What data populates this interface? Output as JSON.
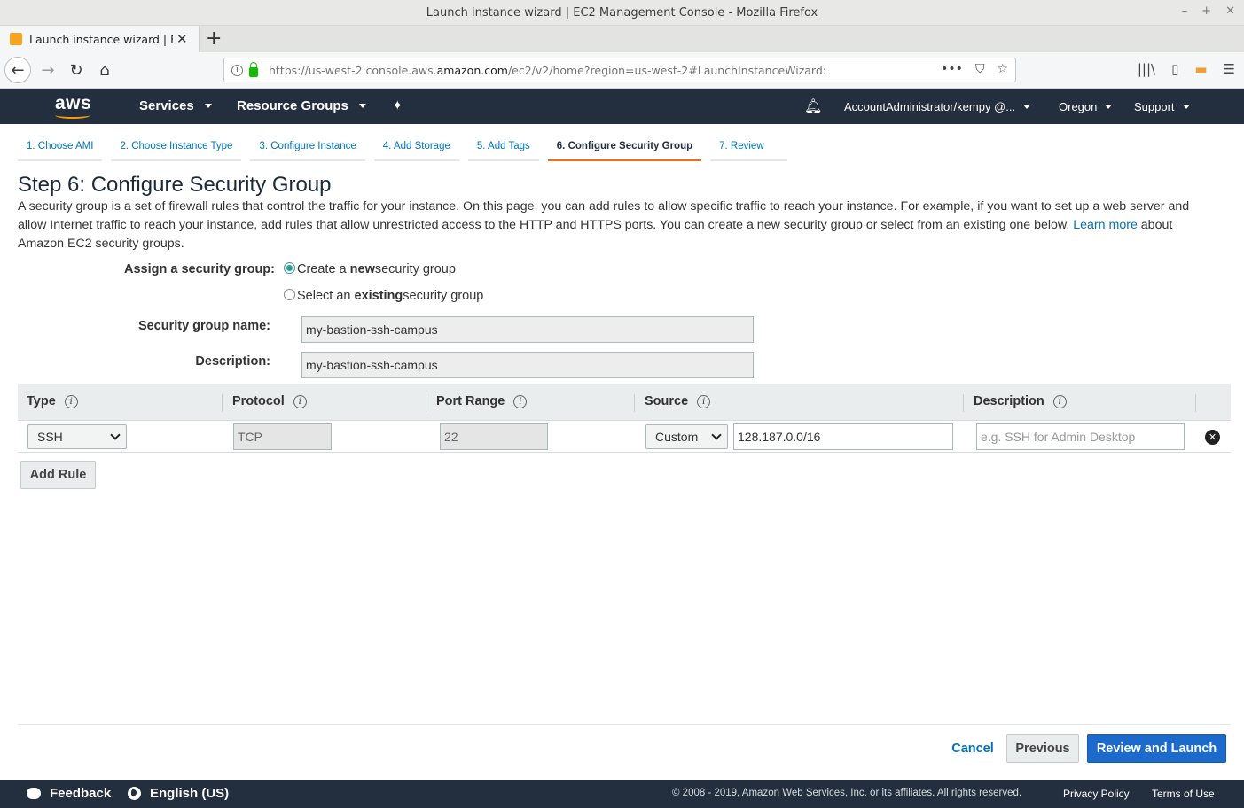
{
  "browser": {
    "window_title": "Launch instance wizard | EC2 Management Console - Mozilla Firefox",
    "tab_title": "Launch instance wizard | EC2",
    "url_prefix": "https://us-west-2.console.aws.",
    "url_domain": "amazon.com",
    "url_suffix": "/ec2/v2/home?region=us-west-2#LaunchInstanceWizard:"
  },
  "aws_header": {
    "logo": "aws",
    "services": "Services",
    "resource_groups": "Resource Groups",
    "account": "AccountAdministrator/kempy @...",
    "region": "Oregon",
    "support": "Support"
  },
  "steps": [
    {
      "label": "1. Choose AMI",
      "active": false
    },
    {
      "label": "2. Choose Instance Type",
      "active": false
    },
    {
      "label": "3. Configure Instance",
      "active": false
    },
    {
      "label": "4. Add Storage",
      "active": false
    },
    {
      "label": "5. Add Tags",
      "active": false
    },
    {
      "label": "6. Configure Security Group",
      "active": true
    },
    {
      "label": "7. Review",
      "active": false
    }
  ],
  "page": {
    "title": "Step 6: Configure Security Group",
    "intro": "A security group is a set of firewall rules that control the traffic for your instance. On this page, you can add rules to allow specific traffic to reach your instance. For example, if you want to set up a web server and allow Internet traffic to reach your instance, add rules that allow unrestricted access to the HTTP and HTTPS ports. You can create a new security group or select from an existing one below.",
    "learn_more": "Learn more",
    "intro_tail": "about Amazon EC2 security groups."
  },
  "form": {
    "assign_label": "Assign a security group:",
    "option_create_pre": "Create a ",
    "option_create_bold": "new",
    "option_create_post": " security group",
    "option_existing_pre": "Select an ",
    "option_existing_bold": "existing",
    "option_existing_post": " security group",
    "selected_option": "create",
    "name_label": "Security group name:",
    "name_value": "my-bastion-ssh-campus",
    "description_label": "Description:",
    "description_value": "my-bastion-ssh-campus"
  },
  "rules_table": {
    "headers": [
      "Type",
      "Protocol",
      "Port Range",
      "Source",
      "Description"
    ],
    "rows": [
      {
        "type": "SSH",
        "protocol": "TCP",
        "port_range": "22",
        "source_mode": "Custom",
        "source_cidr": "128.187.0.0/16",
        "description_placeholder": "e.g. SSH for Admin Desktop"
      }
    ],
    "add_rule": "Add Rule"
  },
  "actions": {
    "cancel": "Cancel",
    "previous": "Previous",
    "review_launch": "Review and Launch"
  },
  "footer": {
    "feedback": "Feedback",
    "language": "English (US)",
    "copyright": "© 2008 - 2019, Amazon Web Services, Inc. or its affiliates. All rights reserved.",
    "privacy": "Privacy Policy",
    "terms": "Terms of Use"
  },
  "colors": {
    "aws_nav_bg": "#232f3e",
    "active_step_underline": "#ec7211",
    "link": "#0073bb",
    "primary_button": "#1c6bcc"
  }
}
